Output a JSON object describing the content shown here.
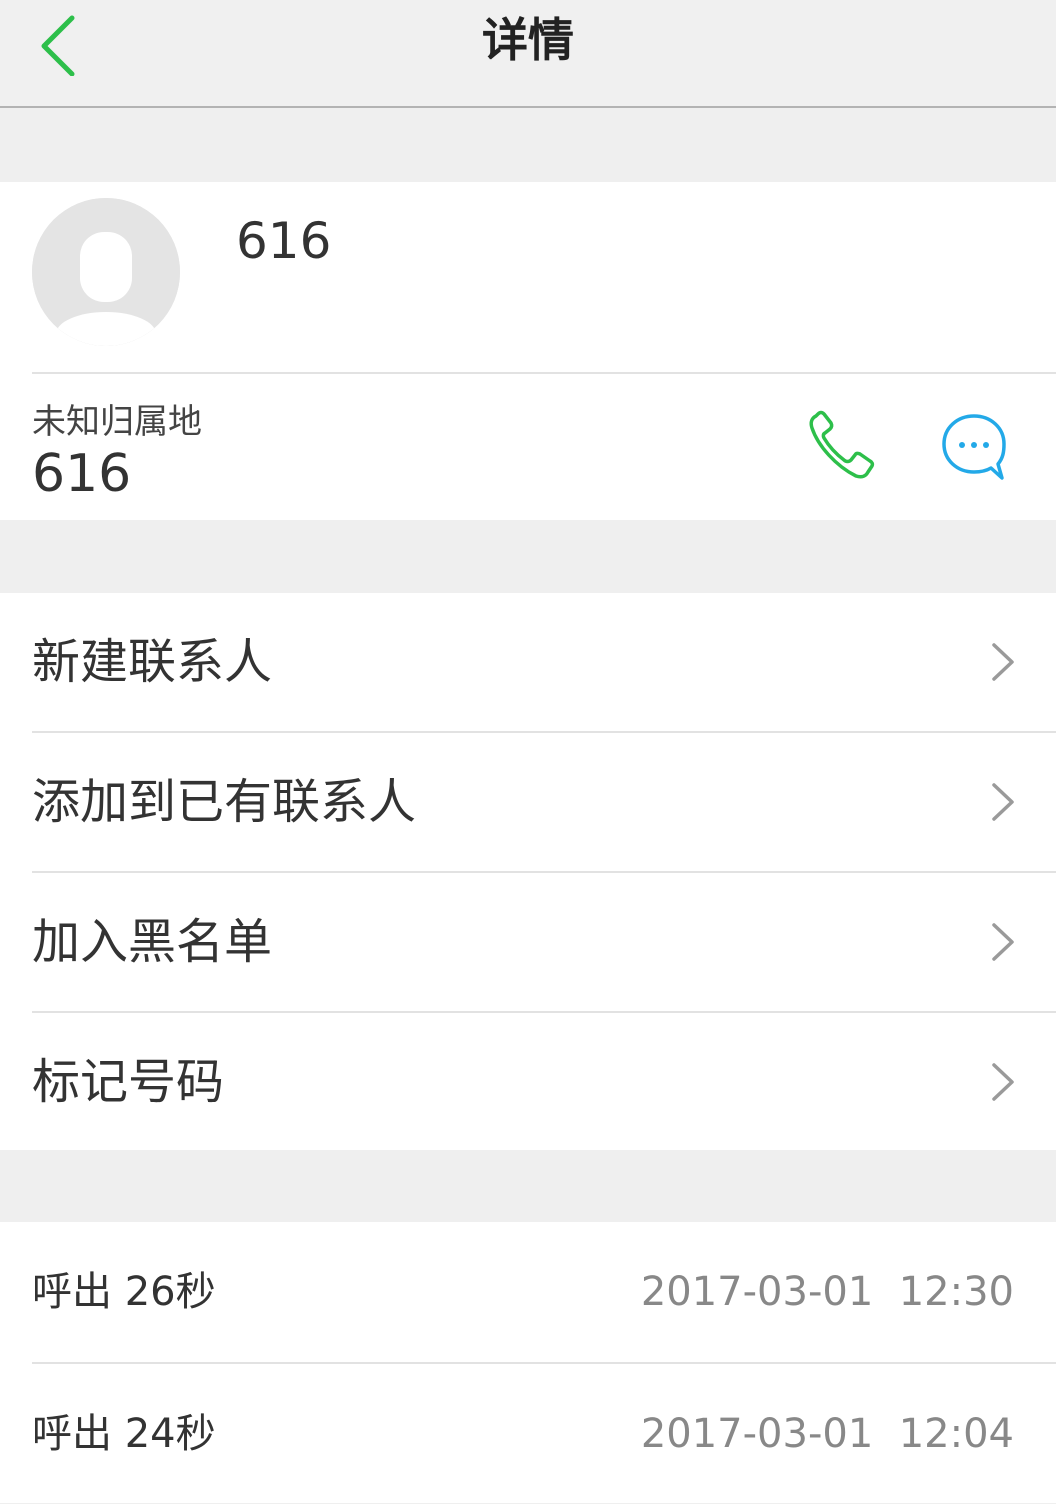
{
  "header": {
    "title": "详情"
  },
  "contact": {
    "name": "616",
    "location": "未知归属地",
    "number": "616"
  },
  "menu": [
    {
      "label": "新建联系人"
    },
    {
      "label": "添加到已有联系人"
    },
    {
      "label": "加入黑名单"
    },
    {
      "label": "标记号码"
    }
  ],
  "call_log": [
    {
      "type": "呼出",
      "duration": "26秒",
      "datetime": "2017-03-01  12:30"
    },
    {
      "type": "呼出",
      "duration": "24秒",
      "datetime": "2017-03-01  12:04"
    }
  ],
  "colors": {
    "accent_green": "#2dbf4a",
    "accent_blue": "#23a9e8"
  },
  "icons": [
    "back-arrow-icon",
    "avatar-placeholder-icon",
    "phone-icon",
    "message-icon",
    "chevron-right-icon"
  ]
}
